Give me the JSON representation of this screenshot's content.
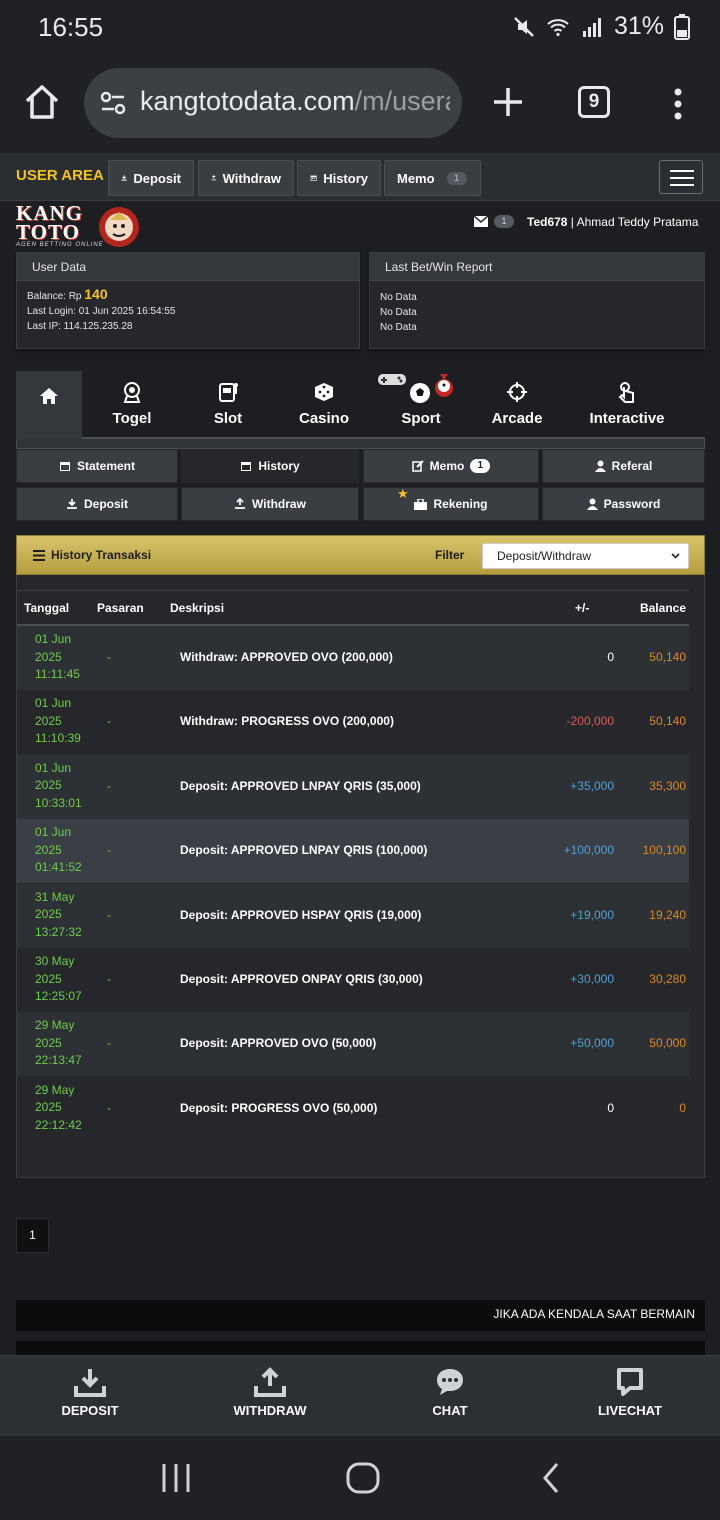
{
  "status": {
    "time": "16:55",
    "battery": "31%"
  },
  "browser": {
    "url_host": "kangtotodata.com",
    "url_path": "/m/usera",
    "tab_count": "9"
  },
  "nav": {
    "user_area": "USER AREA",
    "deposit": "Deposit",
    "withdraw": "Withdraw",
    "history": "History",
    "memo": "Memo",
    "memo_count": "1"
  },
  "logo": {
    "line1": "KANG",
    "line2": "TOTO",
    "tagline": "AGEN BETTING ONLINE"
  },
  "inbox_count": "1",
  "user": {
    "username": "Ted678",
    "separator": " | ",
    "fullname": "Ahmad Teddy Pratama"
  },
  "user_data": {
    "title": "User Data",
    "balance_label": "Balance: Rp",
    "balance_value": "140",
    "last_login": "Last Login: 01 Jun 2025 16:54:55",
    "last_ip": "Last IP: 114.125.235.28"
  },
  "last_bet": {
    "title": "Last Bet/Win Report",
    "lines": [
      "No Data",
      "No Data",
      "No Data"
    ]
  },
  "game_tabs": [
    "Togel",
    "Slot",
    "Casino",
    "Sport",
    "Arcade",
    "Interactive"
  ],
  "menu": {
    "statement": "Statement",
    "history": "History",
    "memo": "Memo",
    "memo_count": "1",
    "referal": "Referal",
    "deposit": "Deposit",
    "withdraw": "Withdraw",
    "rekening": "Rekening",
    "password": "Password"
  },
  "history": {
    "title": "History Transaksi",
    "filter_label": "Filter",
    "filter_value": "Deposit/Withdraw",
    "columns": [
      "Tanggal",
      "Pasaran",
      "Deskripsi",
      "+/-",
      "Balance"
    ],
    "rows": [
      {
        "d1": "01 Jun",
        "d2": "2025",
        "d3": "11:11:45",
        "pasaran": "-",
        "desc": "Withdraw: APPROVED OVO (200,000)",
        "amount": "0",
        "amount_color": "#ffffff",
        "balance": "50,140"
      },
      {
        "d1": "01 Jun",
        "d2": "2025",
        "d3": "11:10:39",
        "pasaran": "-",
        "desc": "Withdraw: PROGRESS OVO (200,000)",
        "amount": "-200,000",
        "amount_color": "#e05a5a",
        "balance": "50,140"
      },
      {
        "d1": "01 Jun",
        "d2": "2025",
        "d3": "10:33:01",
        "pasaran": "-",
        "desc": "Deposit: APPROVED LNPAY QRIS (35,000)",
        "amount": "+35,000",
        "amount_color": "#4fa3d9",
        "balance": "35,300"
      },
      {
        "d1": "01 Jun",
        "d2": "2025",
        "d3": "01:41:52",
        "pasaran": "-",
        "desc": "Deposit: APPROVED LNPAY QRIS (100,000)",
        "amount": "+100,000",
        "amount_color": "#4fa3d9",
        "balance": "100,100"
      },
      {
        "d1": "31 May",
        "d2": "2025",
        "d3": "13:27:32",
        "pasaran": "-",
        "desc": "Deposit: APPROVED HSPAY QRIS (19,000)",
        "amount": "+19,000",
        "amount_color": "#4fa3d9",
        "balance": "19,240"
      },
      {
        "d1": "30 May",
        "d2": "2025",
        "d3": "12:25:07",
        "pasaran": "-",
        "desc": "Deposit: APPROVED ONPAY QRIS (30,000)",
        "amount": "+30,000",
        "amount_color": "#4fa3d9",
        "balance": "30,280"
      },
      {
        "d1": "29 May",
        "d2": "2025",
        "d3": "22:13:47",
        "pasaran": "-",
        "desc": "Deposit: APPROVED OVO (50,000)",
        "amount": "+50,000",
        "amount_color": "#4fa3d9",
        "balance": "50,000"
      },
      {
        "d1": "29 May",
        "d2": "2025",
        "d3": "22:12:42",
        "pasaran": "-",
        "desc": "Deposit: PROGRESS OVO (50,000)",
        "amount": "0",
        "amount_color": "#ffffff",
        "balance": "0"
      }
    ]
  },
  "pagination": {
    "current": "1"
  },
  "marquee": "JIKA ADA KENDALA SAAT BERMAIN",
  "bottom_bar": [
    "DEPOSIT",
    "WITHDRAW",
    "CHAT",
    "LIVECHAT"
  ],
  "colors": {
    "accent_gold": "#f5c518",
    "date_green": "#6fcf4a",
    "balance_orange": "#e08a1e"
  }
}
